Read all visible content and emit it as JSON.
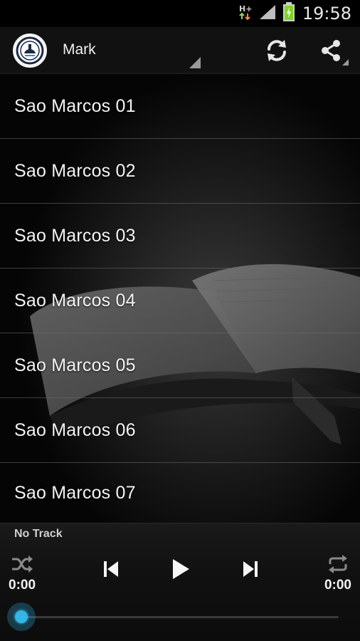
{
  "status_bar": {
    "time": "19:58",
    "icons": [
      "data-transfer-icon",
      "signal-icon",
      "battery-charging-icon"
    ],
    "battery_color": "#7ed321"
  },
  "action_bar": {
    "logo_icon": "app-logo-icon",
    "spinner_label": "Mark",
    "actions": [
      "refresh-icon",
      "share-icon"
    ]
  },
  "tracks": [
    {
      "title": "Sao Marcos 01"
    },
    {
      "title": "Sao Marcos 02"
    },
    {
      "title": "Sao Marcos 03"
    },
    {
      "title": "Sao Marcos 04"
    },
    {
      "title": "Sao Marcos 05"
    },
    {
      "title": "Sao Marcos 06"
    },
    {
      "title": "Sao Marcos 07"
    }
  ],
  "player": {
    "now_playing": "No Track",
    "elapsed": "0:00",
    "duration": "0:00",
    "progress": 0,
    "controls": [
      "shuffle-icon",
      "previous-icon",
      "play-icon",
      "next-icon",
      "repeat-icon"
    ],
    "accent": "#33b5e5"
  }
}
